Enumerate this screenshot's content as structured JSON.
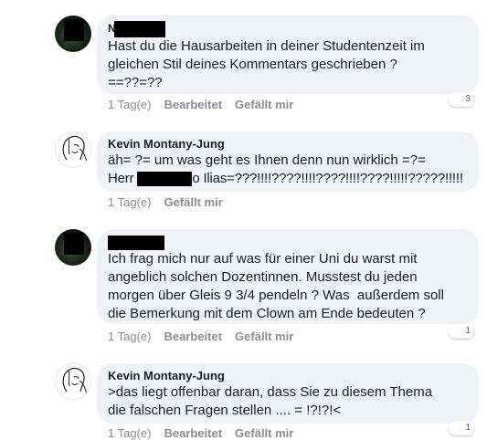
{
  "comments": [
    {
      "author_visible": "N",
      "text": "Hast du die Hausarbeiten in deiner Studentenzeit im\ngleichen Stil deines Kommentars geschrieben ?\n==??=??",
      "time": "1 Tag(e)",
      "edited": "Bearbeitet",
      "like": "Gefällt mir",
      "reactions": "3"
    },
    {
      "author": "Kevin Montany-Jung",
      "line1": "äh= ?= um was geht es Ihnen denn nun wirklich =?=",
      "line2_prefix": "Herr",
      "line2_suffix": "o Ilias=???!!!!????!!!!????!!!!????!!!!!?????!!!!!",
      "time": "1 Tag(e)",
      "like": "Gefällt mir"
    },
    {
      "text": "Ich frag mich nur auf was für einer Uni du warst mit\nangeblich solchen Dozentinnen. Musstest du jeden\nmorgen über Gleis 9 3/4 pendeln ? Was  außerdem soll\ndie Bemerkung mit dem Clown am Ende bedeuten ?",
      "time": "1 Tag(e)",
      "edited": "Bearbeitet",
      "like": "Gefällt mir",
      "reactions": "1"
    },
    {
      "author": "Kevin Montany-Jung",
      "text": ">das liegt offenbar daran, dass Sie zu diesem Thema\ndie falschen Fragen stellen .... = !?!?!<",
      "time": "1 Tag(e)",
      "edited": "Bearbeitet",
      "like": "Gefällt mir",
      "reactions": "1"
    }
  ]
}
